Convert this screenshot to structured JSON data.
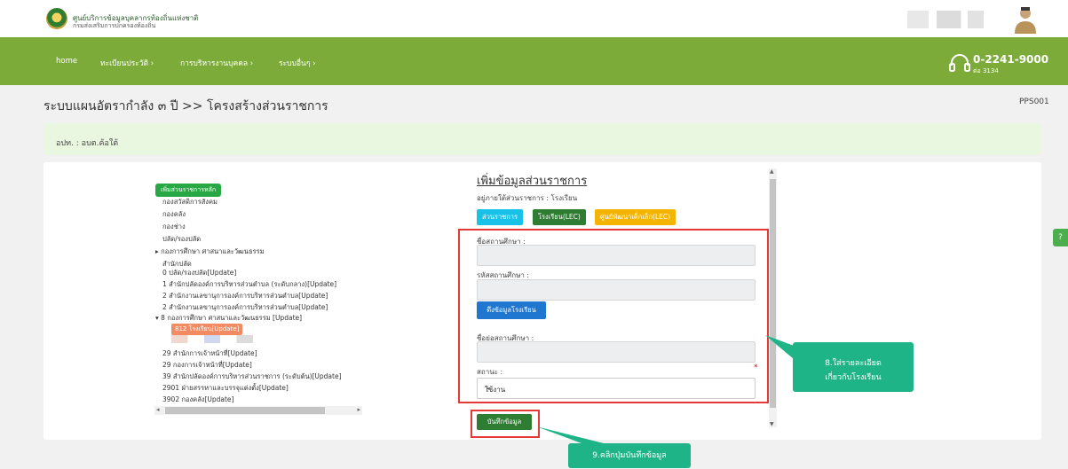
{
  "header": {
    "org_line1": "ศูนย์บริการข้อมูลบุคลากรท้องถิ่นแห่งชาติ",
    "org_line2": "กรมส่งเสริมการปกครองท้องถิ่น"
  },
  "nav": {
    "items": [
      "home",
      "ทะเบียนประวัติ ›",
      "การบริหารงานบุคคล ›",
      "ระบบอื่นๆ ›"
    ],
    "phone": "0-2241-9000",
    "phone_ext": "ต่อ 3134"
  },
  "page": {
    "title": "ระบบแผนอัตรากำลัง ๓ ปี >> โครงสร้างส่วนราชการ",
    "code": "PPS001",
    "info": "อปท. : อบต.ค้อใต้"
  },
  "tree": {
    "add_button": "เพิ่มส่วนราชการหลัก",
    "items": [
      "กองสวัสดิการสังคม",
      "กองคลัง",
      "กองช่าง",
      "ปลัด/รองปลัด",
      "▸ กองการศึกษา ศาสนาและวัฒนธรรม",
      "สำนักปลัด",
      "0 ปลัด/รองปลัด[Update]",
      "1 สำนักปลัดองค์การบริหารส่วนตำบล (ระดับกลาง)[Update]",
      "2 สำนักงานเลขานุการองค์การบริหารส่วนตำบล[Update]",
      "2 สำนักงานเลขานุการองค์การบริหารส่วนตำบล[Update]",
      "▾ 8 กองการศึกษา ศาสนาและวัฒนธรรม [Update]"
    ],
    "selected": "812 โรงเรียน[Update]",
    "items_after": [
      "29 สำนักการเจ้าหน้าที่[Update]",
      "29 กองการเจ้าหน้าที่[Update]",
      "39 สำนักปลัดองค์การบริหารส่วนราชการ (ระดับต้น)[Update]",
      "2901 ฝ่ายสรรหาและบรรจุแต่งตั้ง[Update]",
      "3902 กองคลัง[Update]"
    ]
  },
  "form": {
    "title": "เพิ่มข้อมูลส่วนราชการ",
    "under": "อยู่ภายใต้ส่วนราชการ : โรงเรียน",
    "tabs": [
      "ส่วนราชการ",
      "โรงเรียน(LEC)",
      "ศูนย์พัฒนาเด็กเล็ก(LEC)"
    ],
    "school_name_label": "ชื่อสถานศึกษา :",
    "school_code_label": "รหัสสถานศึกษา :",
    "fetch_button": "ดึงข้อมูลโรงเรียน",
    "short_name_label": "ชื่อย่อสถานศึกษา :",
    "status_label": "สถานะ :",
    "status_value": "ใช้งาน",
    "required_mark": "*",
    "save_button": "บันทึกข้อมูล"
  },
  "callouts": {
    "c1_line1": "8.ใส่รายละเอียด",
    "c1_line2": "เกี่ยวกับโรงเรียน",
    "c2": "9.คลิกปุ่มบันทึกข้อมูล"
  },
  "side_tab": "?",
  "colors": {
    "nav_green": "#7cab3a",
    "callout": "#1fb488",
    "highlight": "#e53935",
    "tab1": "#17c1e8",
    "tab2": "#2e7d32",
    "tab3": "#f5b400"
  }
}
